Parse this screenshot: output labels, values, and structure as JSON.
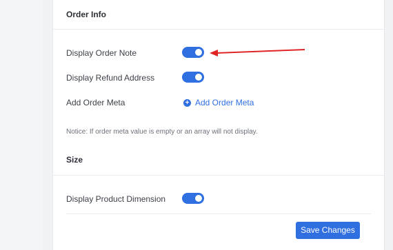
{
  "order_info": {
    "title": "Order Info",
    "rows": [
      {
        "label": "Display Order Note",
        "enabled": true
      },
      {
        "label": "Display Refund Address",
        "enabled": true
      }
    ],
    "order_meta": {
      "label": "Add Order Meta",
      "link_text": "Add Order Meta"
    },
    "notice": "Notice: If order meta value is empty or an array will not display."
  },
  "size": {
    "title": "Size",
    "rows": [
      {
        "label": "Display Product Dimension",
        "enabled": true
      }
    ]
  },
  "actions": {
    "save_label": "Save Changes"
  },
  "colors": {
    "accent": "#2f6fe0",
    "annotation_arrow": "#e02424"
  },
  "icons": {
    "add": "plus-circle-icon"
  }
}
